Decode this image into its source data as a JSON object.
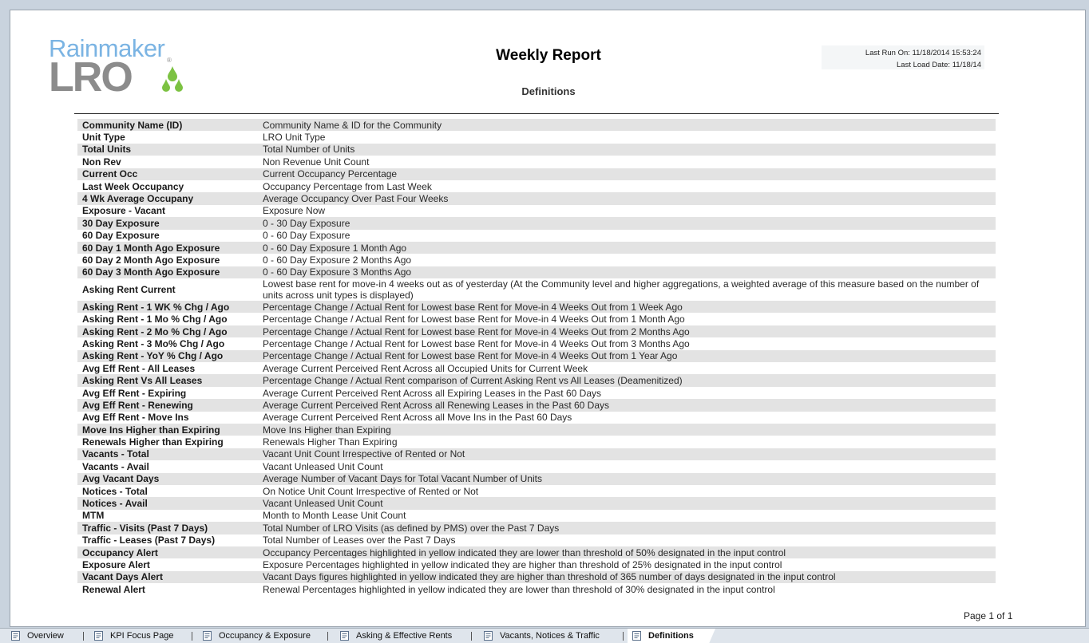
{
  "logo": {
    "top_text": "Rainmaker",
    "bottom_text": "LRO",
    "reg_mark": "®"
  },
  "report": {
    "title": "Weekly Report",
    "subtitle": "Definitions",
    "last_run": "Last Run On: 11/18/2014 15:53:24",
    "last_load": "Last Load Date: 11/18/14",
    "page": "Page 1 of 1"
  },
  "definitions": [
    {
      "term": "Community Name (ID)",
      "desc": "Community Name & ID for the Community"
    },
    {
      "term": "Unit Type",
      "desc": "LRO Unit Type"
    },
    {
      "term": "Total Units",
      "desc": "Total Number of Units"
    },
    {
      "term": "Non Rev",
      "desc": "Non Revenue Unit Count"
    },
    {
      "term": "Current Occ",
      "desc": "Current Occupancy Percentage"
    },
    {
      "term": "Last Week Occupancy",
      "desc": "Occupancy Percentage from Last Week"
    },
    {
      "term": "4 Wk Average Occupany",
      "desc": "Average Occupancy Over Past Four Weeks"
    },
    {
      "term": "Exposure - Vacant",
      "desc": "Exposure Now"
    },
    {
      "term": "30 Day Exposure",
      "desc": "0 - 30 Day Exposure"
    },
    {
      "term": "60 Day Exposure",
      "desc": "0 - 60 Day Exposure"
    },
    {
      "term": "60 Day 1 Month Ago Exposure",
      "desc": "0 - 60 Day Exposure 1 Month Ago"
    },
    {
      "term": "60 Day 2 Month Ago Exposure",
      "desc": "0 - 60 Day Exposure 2 Months Ago"
    },
    {
      "term": "60 Day 3 Month Ago Exposure",
      "desc": "0 - 60 Day Exposure 3 Months Ago"
    },
    {
      "term": "Asking Rent Current",
      "desc": "Lowest base rent for move-in 4 weeks out as of yesterday (At the Community level and higher aggregations, a weighted average of this measure based on the number of units across unit types is displayed)"
    },
    {
      "term": "Asking Rent - 1 WK % Chg / Ago",
      "desc": "Percentage Change / Actual Rent for Lowest base Rent for Move-in 4 Weeks Out from 1 Week Ago"
    },
    {
      "term": "Asking Rent - 1 Mo % Chg / Ago",
      "desc": "Percentage Change / Actual Rent for Lowest base Rent for Move-in 4 Weeks Out from 1 Month Ago"
    },
    {
      "term": "Asking Rent - 2 Mo % Chg / Ago",
      "desc": "Percentage Change / Actual Rent for Lowest base Rent for Move-in 4 Weeks Out from 2 Months Ago"
    },
    {
      "term": "Asking Rent - 3 Mo% Chg / Ago",
      "desc": "Percentage Change / Actual Rent for Lowest base Rent for Move-in 4 Weeks Out from 3 Months Ago"
    },
    {
      "term": "Asking Rent - YoY % Chg / Ago",
      "desc": "Percentage Change / Actual Rent for Lowest base Rent for Move-in 4 Weeks Out from 1 Year Ago"
    },
    {
      "term": "Avg Eff Rent  - All Leases",
      "desc": "Average Current Perceived Rent Across all Occupied Units for Current Week"
    },
    {
      "term": "Asking Rent Vs All Leases",
      "desc": "Percentage Change / Actual Rent comparison of Current Asking Rent vs All Leases (Deamenitized)"
    },
    {
      "term": "Avg Eff Rent - Expiring",
      "desc": "Average Current Perceived Rent Across all Expiring Leases in the Past 60 Days"
    },
    {
      "term": "Avg Eff Rent - Renewing",
      "desc": "Average Current Perceived Rent Across all Renewing Leases in the Past 60 Days"
    },
    {
      "term": "Avg Eff Rent - Move Ins",
      "desc": "Average Current Perceived Rent Across all Move Ins in the Past 60 Days"
    },
    {
      "term": "Move Ins Higher than Expiring",
      "desc": "Move Ins Higher than Expiring"
    },
    {
      "term": "Renewals Higher than Expiring",
      "desc": "Renewals Higher Than Expiring"
    },
    {
      "term": "Vacants - Total",
      "desc": "Vacant Unit Count Irrespective of Rented or Not"
    },
    {
      "term": "Vacants - Avail",
      "desc": "Vacant Unleased Unit Count"
    },
    {
      "term": "Avg Vacant Days",
      "desc": "Average Number of Vacant Days for Total Vacant Number of Units"
    },
    {
      "term": "Notices - Total",
      "desc": "On Notice Unit Count Irrespective of Rented or Not"
    },
    {
      "term": "Notices - Avail",
      "desc": "Vacant Unleased Unit Count"
    },
    {
      "term": "MTM",
      "desc": "Month to Month Lease Unit Count"
    },
    {
      "term": "Traffic - Visits (Past 7 Days)",
      "desc": "Total Number of LRO Visits (as defined by PMS) over the Past 7 Days"
    },
    {
      "term": "Traffic - Leases (Past 7 Days)",
      "desc": "Total Number of Leases over the Past 7 Days"
    },
    {
      "term": "Occupancy Alert",
      "desc": "Occupancy Percentages highlighted in yellow indicated they are lower than threshold of 50% designated in the input control"
    },
    {
      "term": "Exposure Alert",
      "desc": "Exposure Percentages highlighted in yellow indicated they are higher than threshold of 25% designated in the input control"
    },
    {
      "term": "Vacant Days Alert",
      "desc": "Vacant Days figures highlighted in yellow indicated they are higher than threshold of 365 number of days designated in the input control"
    },
    {
      "term": "Renewal Alert",
      "desc": "Renewal Percentages highlighted in yellow indicated they are lower than threshold of 30% designated in the input control"
    }
  ],
  "tabs": [
    {
      "label": "Overview",
      "name": "tab-overview",
      "active": false
    },
    {
      "label": "KPI Focus Page",
      "name": "tab-kpi-focus-page",
      "active": false
    },
    {
      "label": "Occupancy & Exposure",
      "name": "tab-occupancy-exposure",
      "active": false
    },
    {
      "label": "Asking & Effective Rents",
      "name": "tab-asking-effective-rents",
      "active": false
    },
    {
      "label": "Vacants, Notices & Traffic",
      "name": "tab-vacants-notices-traffic",
      "active": false
    },
    {
      "label": "Definitions",
      "name": "tab-definitions",
      "active": true
    }
  ],
  "colors": {
    "logo_blue": "#7bb4e3",
    "logo_gray": "#8c8c8c",
    "logo_green": "#7cc242",
    "row_stripe": "#e3e3e3",
    "tabbar_bg": "#dfe5ec"
  },
  "icons": {
    "tab_icon": "report-page-icon"
  }
}
